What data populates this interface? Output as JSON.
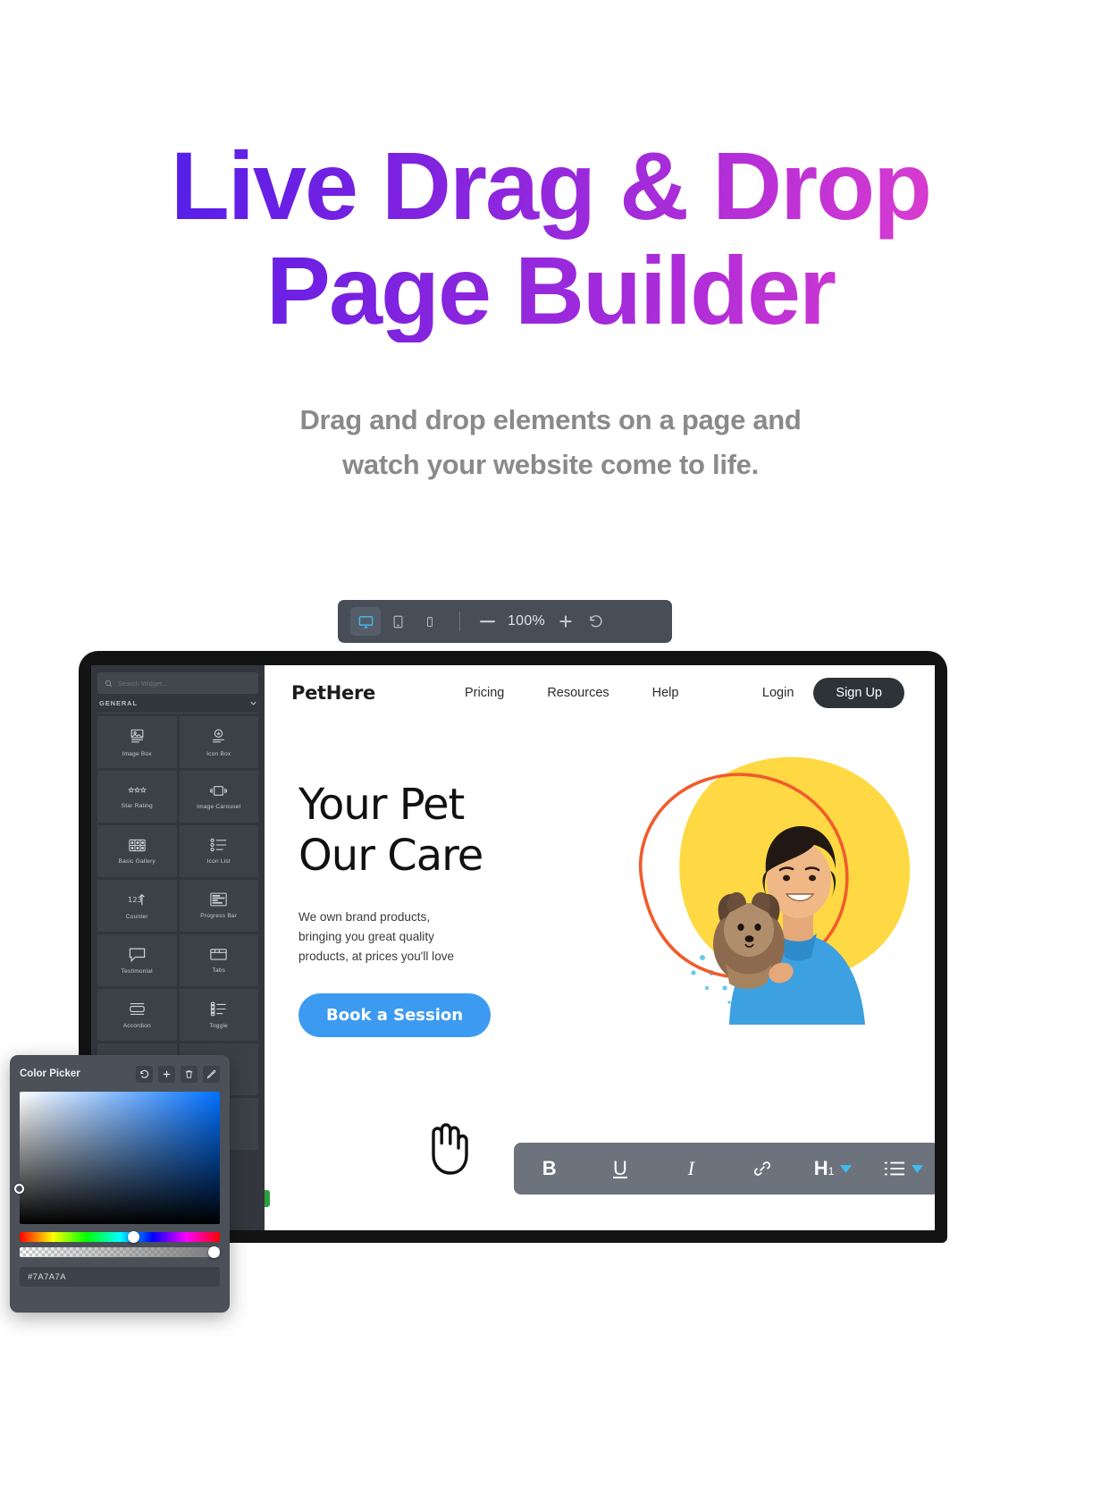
{
  "hero": {
    "title_line1": "Live Drag & Drop",
    "title_line2": "Page Builder",
    "subtitle_line1": "Drag and drop elements on a page and",
    "subtitle_line2": "watch your website come to life.",
    "gradient_start": "#3b1ef0",
    "gradient_end": "#ef45cf",
    "subtitle_color": "#8a8a8a"
  },
  "device_toolbar": {
    "desktop_label": "desktop",
    "tablet_label": "tablet",
    "mobile_label": "mobile",
    "zoom_out_label": "—",
    "zoom_value": "100%",
    "zoom_in_label": "+",
    "reset_label": "reset",
    "active_device": "desktop",
    "active_color": "#3fbdf0",
    "background": "#474e58"
  },
  "builder": {
    "search": {
      "placeholder": "Search Widget..."
    },
    "category": {
      "label": "GENERAL"
    },
    "widgets": [
      {
        "label": "Image Box",
        "icon": "image-box-icon"
      },
      {
        "label": "Icon Box",
        "icon": "icon-box-icon"
      },
      {
        "label": "Star Rating",
        "icon": "star-rating-icon"
      },
      {
        "label": "Image Carousel",
        "icon": "image-carousel-icon"
      },
      {
        "label": "Basic Gallery",
        "icon": "basic-gallery-icon"
      },
      {
        "label": "Icon List",
        "icon": "icon-list-icon"
      },
      {
        "label": "Counter",
        "icon": "counter-icon"
      },
      {
        "label": "Progress Bar",
        "icon": "progress-bar-icon"
      },
      {
        "label": "Testimonial",
        "icon": "testimonial-icon"
      },
      {
        "label": "Tabs",
        "icon": "tabs-icon"
      },
      {
        "label": "Accordion",
        "icon": "accordion-icon"
      },
      {
        "label": "Toggle",
        "icon": "toggle-icon"
      }
    ]
  },
  "site": {
    "brand": "PetHere",
    "nav_links": [
      "Pricing",
      "Resources",
      "Help"
    ],
    "login_label": "Login",
    "signup_label": "Sign Up",
    "hero_title_line1": "Your Pet",
    "hero_title_line2": "Our Care",
    "hero_body_line1": "We own brand products,",
    "hero_body_line2": "bringing you great quality",
    "hero_body_line3": "products, at prices you'll love",
    "cta_label": "Book a Session",
    "cta_color": "#3c9bf0",
    "blob_color": "#ffd943",
    "outline_color": "#f05c2c",
    "dots_color": "#4ec3e8"
  },
  "rich_text_toolbar": {
    "bold_label": "B",
    "underline_label": "U",
    "italic_label": "I",
    "link_label": "link",
    "heading_label": "H",
    "heading_level": "1",
    "list_label": "list",
    "background": "#6d737c"
  },
  "color_picker": {
    "title": "Color Picker",
    "actions": [
      "reset-icon",
      "add-icon",
      "delete-icon",
      "eyedropper-icon"
    ],
    "hex_value": "#7A7A7A",
    "panel_color": "#4b5059"
  }
}
